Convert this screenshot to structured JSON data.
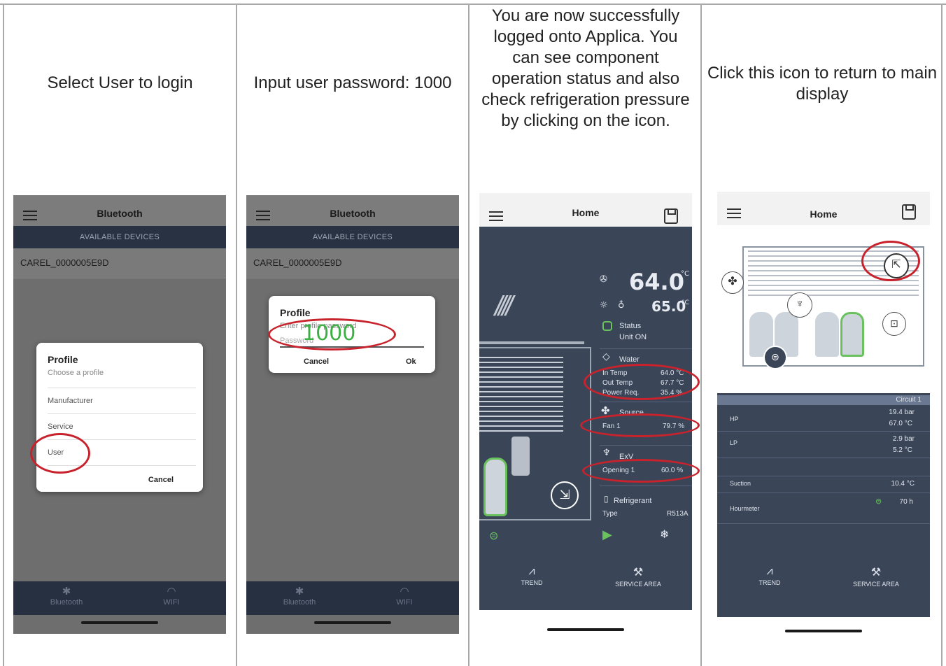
{
  "captions": [
    "Select User to login",
    "Input user password: 1000",
    "You are now successfully logged onto Applica. You can see component operation status and also check refrigeration pressure by clicking on the icon.",
    "Click this icon to return to main display"
  ],
  "bluetooth": {
    "title": "Bluetooth",
    "available_devices": "AVAILABLE DEVICES",
    "device": "CAREL_0000005E9D",
    "nav_bluetooth": "Bluetooth",
    "nav_wifi": "WIFI"
  },
  "profile_dialog": {
    "title": "Profile",
    "subtitle": "Choose a profile",
    "options": [
      "Manufacturer",
      "Service",
      "User"
    ],
    "cancel": "Cancel"
  },
  "password_dialog": {
    "title": "Profile",
    "subtitle": "Enter profile password",
    "placeholder": "Password",
    "typed_value": "1000",
    "cancel": "Cancel",
    "ok": "Ok"
  },
  "home": {
    "title": "Home",
    "main_temp": "64.0",
    "main_temp_unit": "°C",
    "second_temp": "65.0",
    "second_temp_unit": "°C",
    "status_label": "Status",
    "status_value": "Unit ON",
    "water_label": "Water",
    "in_temp_label": "In Temp",
    "in_temp_value": "64.0 °C",
    "out_temp_label": "Out Temp",
    "out_temp_value": "67.7 °C",
    "power_req_label": "Power Req.",
    "power_req_value": "35.4 %",
    "source_label": "Source",
    "fan_label": "Fan 1",
    "fan_value": "79.7 %",
    "exv_label": "ExV",
    "opening_label": "Opening 1",
    "opening_value": "60.0 %",
    "refrigerant_label": "Refrigerant",
    "type_label": "Type",
    "type_value": "R513A",
    "nav_trend": "TREND",
    "nav_service": "SERVICE AREA"
  },
  "circuit": {
    "title": "Home",
    "circuit_label": "Circuit 1",
    "hp_label": "HP",
    "hp_pressure": "19.4 bar",
    "hp_temp": "67.0 °C",
    "lp_label": "LP",
    "lp_pressure": "2.9 bar",
    "lp_temp": "5.2 °C",
    "suction_label": "Suction",
    "suction_value": "10.4 °C",
    "hourmeter_label": "Hourmeter",
    "hourmeter_value": "70 h",
    "nav_trend": "TREND",
    "nav_service": "SERVICE AREA"
  }
}
